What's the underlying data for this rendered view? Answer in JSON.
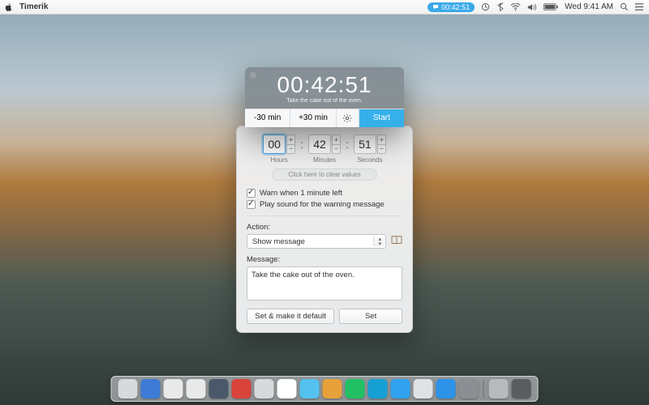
{
  "menubar": {
    "app_name": "Timerik",
    "pill_time": "00:42:51",
    "clock": "Wed 9:41 AM"
  },
  "timer": {
    "display": "00:42:51",
    "subtitle": "Take the cake out of the oven.",
    "minus_label": "-30 min",
    "plus_label": "+30 min",
    "start_label": "Start"
  },
  "settings": {
    "hours_value": "00",
    "minutes_value": "42",
    "seconds_value": "51",
    "hours_label": "Hours",
    "minutes_label": "Minutes",
    "seconds_label": "Seconds",
    "clear_label": "Click here to clear values",
    "warn_label": "Warn when 1 minute left",
    "sound_label": "Play sound for the warning message",
    "action_label": "Action:",
    "action_value": "Show message",
    "message_label": "Message:",
    "message_value": "Take the cake out of the oven.",
    "btn_default": "Set & make it default",
    "btn_set": "Set"
  },
  "dock": {
    "apps": [
      "#d8d9da",
      "#3e7bd6",
      "#e9e9ea",
      "#e9e9ea",
      "#4a586a",
      "#d8433b",
      "#d8d9da",
      "#ffffff",
      "#54c1f0",
      "#e7a13a",
      "#22c064",
      "#17a0d4",
      "#31a2ef",
      "#e0e1e3",
      "#2c93e8",
      "#8c8e93",
      "#b8babc",
      "#5a5c60"
    ]
  }
}
